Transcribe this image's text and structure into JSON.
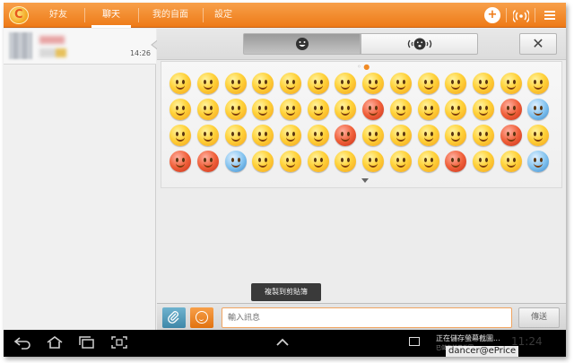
{
  "tabs": [
    {
      "label": "好友",
      "active": false
    },
    {
      "label": "聊天",
      "active": true
    },
    {
      "label": "我的自面",
      "active": false
    },
    {
      "label": "設定",
      "active": false
    }
  ],
  "top_icons": [
    "add-circle-icon",
    "wifi-broadcast-icon",
    "menu-icon"
  ],
  "conversation": {
    "time": "14:26"
  },
  "emoji_panel": {
    "segments": [
      {
        "icon": "smiley-icon",
        "active": true
      },
      {
        "icon": "voice-emoji-icon",
        "active": false
      }
    ],
    "close_symbol": "✕",
    "page_count": 2,
    "active_page": 2,
    "rows": 4,
    "cols": 14
  },
  "toast": "複製到剪貼簿",
  "input": {
    "placeholder": "輸入訊息",
    "send_label": "傳送"
  },
  "system_bar": {
    "notification_title": "正在儲存螢幕截圖...",
    "notification_subtitle": "已儲存螢幕截圖",
    "clock": "11:24"
  },
  "watermark": "dancer@ePrice",
  "colors": {
    "accent": "#ee7a17",
    "toast_bg": "#3a3a3a",
    "bar_bg": "#000000"
  }
}
